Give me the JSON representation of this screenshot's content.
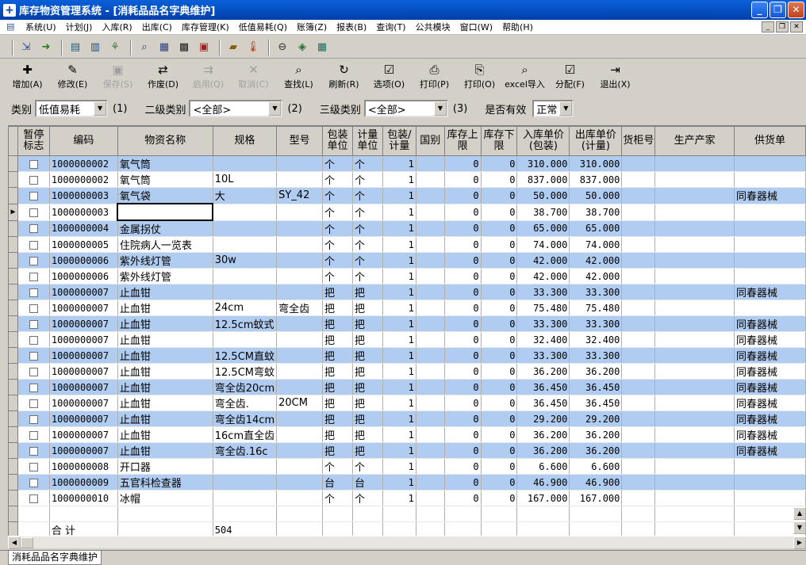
{
  "window": {
    "title": "库存物资管理系统 - [消耗品品名字典维护]"
  },
  "menu": [
    "系统(U)",
    "计划(J)",
    "入库(R)",
    "出库(C)",
    "库存管理(K)",
    "低值易耗(Q)",
    "账簿(Z)",
    "报表(B)",
    "查询(T)",
    "公共模块",
    "窗口(W)",
    "帮助(H)"
  ],
  "toolbar_icons": [
    "door-in-icon",
    "arrow-next-icon",
    "doc-list-icon",
    "doc-edit-icon",
    "tree-icon",
    "search-doc-icon",
    "form-icon",
    "grid-icon",
    "printer-page-icon",
    "book-icon",
    "thermometer-icon",
    "circle-minus-icon",
    "stack-icon",
    "calc-icon"
  ],
  "actions": [
    {
      "label": "增加(A)",
      "icon": "✚",
      "enabled": true
    },
    {
      "label": "修改(E)",
      "icon": "✎",
      "enabled": true
    },
    {
      "label": "保存(S)",
      "icon": "▣",
      "enabled": false
    },
    {
      "label": "作废(D)",
      "icon": "⇄",
      "enabled": true
    },
    {
      "label": "启用(Q)",
      "icon": "⇉",
      "enabled": false
    },
    {
      "label": "取消(C)",
      "icon": "✕",
      "enabled": false
    },
    {
      "label": "查找(L)",
      "icon": "⌕",
      "enabled": true
    },
    {
      "label": "刷新(R)",
      "icon": "↻",
      "enabled": true
    },
    {
      "label": "选项(O)",
      "icon": "☑",
      "enabled": true
    },
    {
      "label": "打印(P)",
      "icon": "⎙",
      "enabled": true
    },
    {
      "label": "打印(O)",
      "icon": "⎘",
      "enabled": true
    },
    {
      "label": "excel导入",
      "icon": "⌕",
      "enabled": true
    },
    {
      "label": "分配(F)",
      "icon": "☑",
      "enabled": true
    },
    {
      "label": "退出(X)",
      "icon": "⇥",
      "enabled": true
    }
  ],
  "filters": {
    "cat1_label": "类别",
    "cat1_value": "低值易耗",
    "cat1_hotkey": "(1)",
    "cat2_label": "二级类别",
    "cat2_value": "<全部>",
    "cat2_hotkey": "(2)",
    "cat3_label": "三级类别",
    "cat3_value": "<全部>",
    "cat3_hotkey": "(3)",
    "valid_label": "是否有效",
    "valid_value": "正常"
  },
  "columns": [
    "暂停标志",
    "编码",
    "物资名称",
    "规格",
    "型号",
    "包装单位",
    "计量单位",
    "包装/计量",
    "国别",
    "库存上限",
    "库存下限",
    "入库单价(包装)",
    "出库单价(计量)",
    "货柜号",
    "生产产家",
    "供货单"
  ],
  "rows": [
    {
      "code": "1000000002",
      "name": "氧气筒",
      "spec": "",
      "model": "",
      "pkg": "个",
      "unit": "个",
      "ratio": "1",
      "country": "",
      "max": "0",
      "min": "0",
      "in_price": "310.000",
      "out_price": "310.000",
      "cabinet": "",
      "maker": "",
      "supplier": ""
    },
    {
      "code": "1000000002",
      "name": "氧气筒",
      "spec": "10L",
      "model": "",
      "pkg": "个",
      "unit": "个",
      "ratio": "1",
      "country": "",
      "max": "0",
      "min": "0",
      "in_price": "837.000",
      "out_price": "837.000",
      "cabinet": "",
      "maker": "",
      "supplier": ""
    },
    {
      "code": "1000000003",
      "name": "氧气袋",
      "spec": "大",
      "model": "SY_42",
      "pkg": "个",
      "unit": "个",
      "ratio": "1",
      "country": "",
      "max": "0",
      "min": "0",
      "in_price": "50.000",
      "out_price": "50.000",
      "cabinet": "",
      "maker": "",
      "supplier": "同春器械"
    },
    {
      "code": "1000000003",
      "name": "氧气袋",
      "spec": "",
      "model": "",
      "pkg": "个",
      "unit": "个",
      "ratio": "1",
      "country": "",
      "max": "0",
      "min": "0",
      "in_price": "38.700",
      "out_price": "38.700",
      "cabinet": "",
      "maker": "",
      "supplier": ""
    },
    {
      "code": "1000000004",
      "name": "金属拐仗",
      "spec": "",
      "model": "",
      "pkg": "个",
      "unit": "个",
      "ratio": "1",
      "country": "",
      "max": "0",
      "min": "0",
      "in_price": "65.000",
      "out_price": "65.000",
      "cabinet": "",
      "maker": "",
      "supplier": ""
    },
    {
      "code": "1000000005",
      "name": "住院病人一览表",
      "spec": "",
      "model": "",
      "pkg": "个",
      "unit": "个",
      "ratio": "1",
      "country": "",
      "max": "0",
      "min": "0",
      "in_price": "74.000",
      "out_price": "74.000",
      "cabinet": "",
      "maker": "",
      "supplier": ""
    },
    {
      "code": "1000000006",
      "name": "紫外线灯管",
      "spec": "30w",
      "model": "",
      "pkg": "个",
      "unit": "个",
      "ratio": "1",
      "country": "",
      "max": "0",
      "min": "0",
      "in_price": "42.000",
      "out_price": "42.000",
      "cabinet": "",
      "maker": "",
      "supplier": ""
    },
    {
      "code": "1000000006",
      "name": "紫外线灯管",
      "spec": "",
      "model": "",
      "pkg": "个",
      "unit": "个",
      "ratio": "1",
      "country": "",
      "max": "0",
      "min": "0",
      "in_price": "42.000",
      "out_price": "42.000",
      "cabinet": "",
      "maker": "",
      "supplier": ""
    },
    {
      "code": "1000000007",
      "name": "止血钳",
      "spec": "",
      "model": "",
      "pkg": "把",
      "unit": "把",
      "ratio": "1",
      "country": "",
      "max": "0",
      "min": "0",
      "in_price": "33.300",
      "out_price": "33.300",
      "cabinet": "",
      "maker": "",
      "supplier": "同春器械"
    },
    {
      "code": "1000000007",
      "name": "止血钳",
      "spec": "24cm",
      "model": "弯全齿",
      "pkg": "把",
      "unit": "把",
      "ratio": "1",
      "country": "",
      "max": "0",
      "min": "0",
      "in_price": "75.480",
      "out_price": "75.480",
      "cabinet": "",
      "maker": "",
      "supplier": ""
    },
    {
      "code": "1000000007",
      "name": "止血钳",
      "spec": "12.5cm蚊式",
      "model": "",
      "pkg": "把",
      "unit": "把",
      "ratio": "1",
      "country": "",
      "max": "0",
      "min": "0",
      "in_price": "33.300",
      "out_price": "33.300",
      "cabinet": "",
      "maker": "",
      "supplier": "同春器械"
    },
    {
      "code": "1000000007",
      "name": "止血钳",
      "spec": "",
      "model": "",
      "pkg": "把",
      "unit": "把",
      "ratio": "1",
      "country": "",
      "max": "0",
      "min": "0",
      "in_price": "32.400",
      "out_price": "32.400",
      "cabinet": "",
      "maker": "",
      "supplier": "同春器械"
    },
    {
      "code": "1000000007",
      "name": "止血钳",
      "spec": "12.5CM直蚊",
      "model": "",
      "pkg": "把",
      "unit": "把",
      "ratio": "1",
      "country": "",
      "max": "0",
      "min": "0",
      "in_price": "33.300",
      "out_price": "33.300",
      "cabinet": "",
      "maker": "",
      "supplier": "同春器械"
    },
    {
      "code": "1000000007",
      "name": "止血钳",
      "spec": "12.5CM弯蚊",
      "model": "",
      "pkg": "把",
      "unit": "把",
      "ratio": "1",
      "country": "",
      "max": "0",
      "min": "0",
      "in_price": "36.200",
      "out_price": "36.200",
      "cabinet": "",
      "maker": "",
      "supplier": "同春器械"
    },
    {
      "code": "1000000007",
      "name": "止血钳",
      "spec": "弯全齿20cm",
      "model": "",
      "pkg": "把",
      "unit": "把",
      "ratio": "1",
      "country": "",
      "max": "0",
      "min": "0",
      "in_price": "36.450",
      "out_price": "36.450",
      "cabinet": "",
      "maker": "",
      "supplier": "同春器械"
    },
    {
      "code": "1000000007",
      "name": "止血钳",
      "spec": "弯全齿.",
      "model": "20CM",
      "pkg": "把",
      "unit": "把",
      "ratio": "1",
      "country": "",
      "max": "0",
      "min": "0",
      "in_price": "36.450",
      "out_price": "36.450",
      "cabinet": "",
      "maker": "",
      "supplier": "同春器械"
    },
    {
      "code": "1000000007",
      "name": "止血钳",
      "spec": "弯全齿14cm",
      "model": "",
      "pkg": "把",
      "unit": "把",
      "ratio": "1",
      "country": "",
      "max": "0",
      "min": "0",
      "in_price": "29.200",
      "out_price": "29.200",
      "cabinet": "",
      "maker": "",
      "supplier": "同春器械"
    },
    {
      "code": "1000000007",
      "name": "止血钳",
      "spec": "16cm直全齿",
      "model": "",
      "pkg": "把",
      "unit": "把",
      "ratio": "1",
      "country": "",
      "max": "0",
      "min": "0",
      "in_price": "36.200",
      "out_price": "36.200",
      "cabinet": "",
      "maker": "",
      "supplier": "同春器械"
    },
    {
      "code": "1000000007",
      "name": "止血钳",
      "spec": "弯全齿.16c",
      "model": "",
      "pkg": "把",
      "unit": "把",
      "ratio": "1",
      "country": "",
      "max": "0",
      "min": "0",
      "in_price": "36.200",
      "out_price": "36.200",
      "cabinet": "",
      "maker": "",
      "supplier": "同春器械"
    },
    {
      "code": "1000000008",
      "name": "开口器",
      "spec": "",
      "model": "",
      "pkg": "个",
      "unit": "个",
      "ratio": "1",
      "country": "",
      "max": "0",
      "min": "0",
      "in_price": "6.600",
      "out_price": "6.600",
      "cabinet": "",
      "maker": "",
      "supplier": ""
    },
    {
      "code": "1000000009",
      "name": "五官科检查器",
      "spec": "",
      "model": "",
      "pkg": "台",
      "unit": "台",
      "ratio": "1",
      "country": "",
      "max": "0",
      "min": "0",
      "in_price": "46.900",
      "out_price": "46.900",
      "cabinet": "",
      "maker": "",
      "supplier": ""
    },
    {
      "code": "1000000010",
      "name": "冰帽",
      "spec": "",
      "model": "",
      "pkg": "个",
      "unit": "个",
      "ratio": "1",
      "country": "",
      "max": "0",
      "min": "0",
      "in_price": "167.000",
      "out_price": "167.000",
      "cabinet": "",
      "maker": "",
      "supplier": ""
    }
  ],
  "total": {
    "label": "合   计",
    "spec_count": "504"
  },
  "tab_label": "消耗品品名字典维护"
}
